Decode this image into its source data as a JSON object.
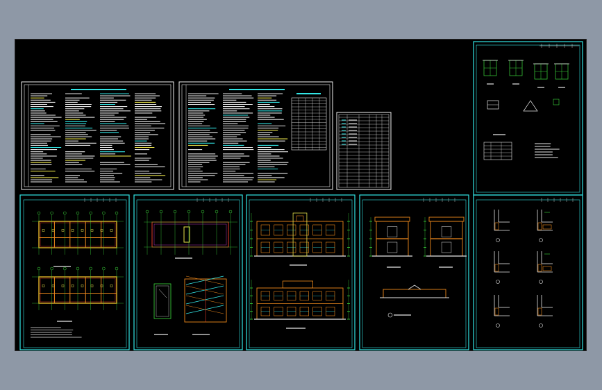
{
  "viewer": {
    "background": "#8e98a6",
    "canvas_background": "#000000"
  },
  "palette": {
    "frame": "#33e6e6",
    "white_frame": "#f2f2f2",
    "text_white": "#e8e8e8",
    "line_green": "#3ddc3d",
    "line_orange": "#f08a1c",
    "line_red": "#e23a2a",
    "line_yellow": "#e8e24a",
    "line_cyan": "#33e6e6",
    "line_magenta": "#e040e0"
  },
  "sheets": [
    {
      "id": "design-notes-1",
      "kind": "notes",
      "frame": "white"
    },
    {
      "id": "design-notes-2",
      "kind": "notes",
      "frame": "white"
    },
    {
      "id": "door-window-schedule",
      "kind": "table",
      "frame": "white"
    },
    {
      "id": "details-top-right",
      "kind": "details",
      "frame": "cyan"
    },
    {
      "id": "floor-plans-1-2",
      "kind": "plan",
      "frame": "cyan"
    },
    {
      "id": "roof-plan-stair",
      "kind": "plan",
      "frame": "cyan"
    },
    {
      "id": "elevations",
      "kind": "elevation",
      "frame": "cyan"
    },
    {
      "id": "sections",
      "kind": "section",
      "frame": "cyan"
    },
    {
      "id": "wall-details",
      "kind": "details",
      "frame": "cyan"
    }
  ]
}
